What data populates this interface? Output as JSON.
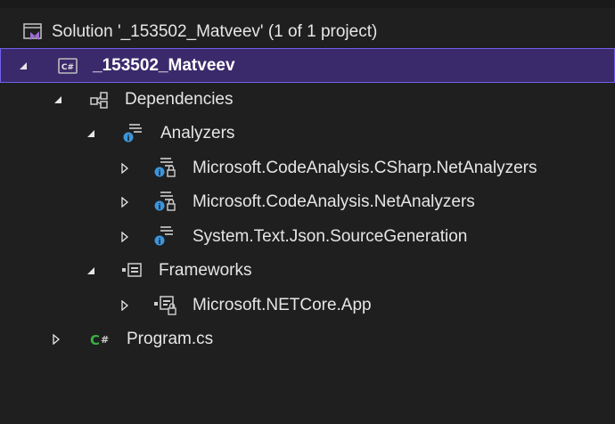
{
  "tree": {
    "solution": {
      "label": "Solution '_153502_Matveev' (1 of 1 project)",
      "icon": "solution-icon"
    },
    "project": {
      "label": "_153502_Matveev",
      "icon": "csharp-project-icon",
      "selected": true
    },
    "dependencies": {
      "label": "Dependencies",
      "icon": "dependencies-icon"
    },
    "analyzers": {
      "label": "Analyzers",
      "icon": "analyzer-icon"
    },
    "analyzer_items": [
      {
        "label": "Microsoft.CodeAnalysis.CSharp.NetAnalyzers",
        "icon": "analyzer-dll-icon"
      },
      {
        "label": "Microsoft.CodeAnalysis.NetAnalyzers",
        "icon": "analyzer-dll-icon"
      },
      {
        "label": "System.Text.Json.SourceGeneration",
        "icon": "analyzer-icon"
      }
    ],
    "frameworks": {
      "label": "Frameworks",
      "icon": "framework-icon"
    },
    "framework_items": [
      {
        "label": "Microsoft.NETCore.App",
        "icon": "framework-ref-icon"
      }
    ],
    "program_file": {
      "label": "Program.cs",
      "icon": "csharp-file-icon"
    }
  },
  "colors": {
    "background": "#1f1f1f",
    "selection": "#3b2a6b",
    "selection_border": "#7160e8",
    "text": "#e6e6e6",
    "csharp_green": "#3cb043",
    "info_blue": "#3a96dd",
    "solution_purple": "#9b6bd6"
  }
}
